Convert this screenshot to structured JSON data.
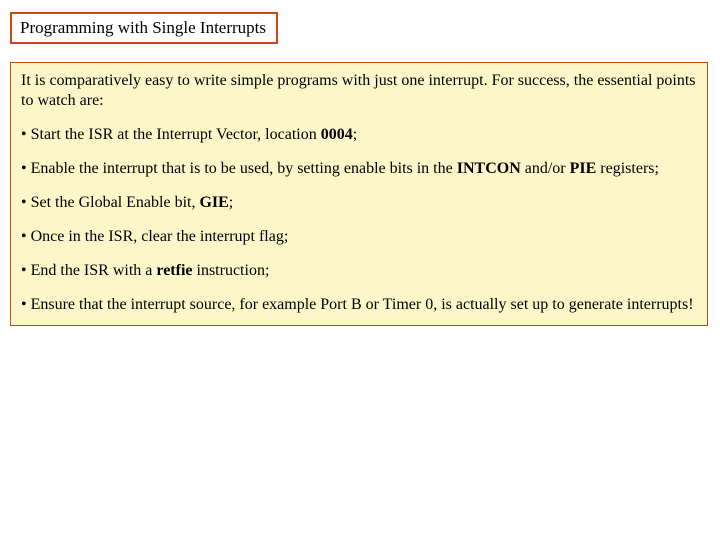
{
  "title": "Programming with Single Interrupts",
  "intro": "It is comparatively easy to write simple programs with just one interrupt. For success, the essential points to watch are:",
  "bullets": [
    {
      "pre": "• Start the ISR at the Interrupt Vector, location ",
      "bold": "0004",
      "post": ";"
    },
    {
      "pre": "• Enable the interrupt that is to be used, by setting enable bits in the ",
      "bold": "INTCON",
      "mid": " and/or ",
      "bold2": "PIE",
      "post": " registers;"
    },
    {
      "pre": "• Set the Global Enable bit, ",
      "bold": "GIE",
      "post": ";"
    },
    {
      "pre": "• Once in the ISR, clear the interrupt flag;",
      "bold": "",
      "post": ""
    },
    {
      "pre": "• End the ISR with a ",
      "bold": "retfie",
      "post": " instruction;"
    },
    {
      "pre": "• Ensure that the interrupt source, for example Port B or Timer 0, is actually set up to generate interrupts!",
      "bold": "",
      "post": ""
    }
  ]
}
